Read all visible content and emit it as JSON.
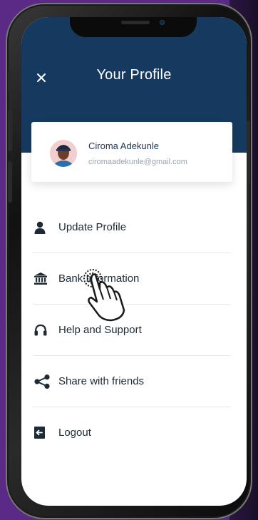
{
  "header": {
    "title": "Your Profile",
    "close_icon": "close-icon"
  },
  "profile": {
    "name": "Ciroma Adekunle",
    "email": "ciromaadekunle@gmail.com"
  },
  "menu": {
    "items": [
      {
        "label": "Update Profile",
        "icon": "person-icon"
      },
      {
        "label": "Bank Information",
        "icon": "bank-icon"
      },
      {
        "label": "Help and Support",
        "icon": "headset-icon"
      },
      {
        "label": "Share with friends",
        "icon": "share-icon"
      },
      {
        "label": "Logout",
        "icon": "logout-icon"
      }
    ]
  },
  "colors": {
    "header_bg": "#163a5f",
    "text_dark": "#1e2a35",
    "background": "#5a2a86"
  }
}
